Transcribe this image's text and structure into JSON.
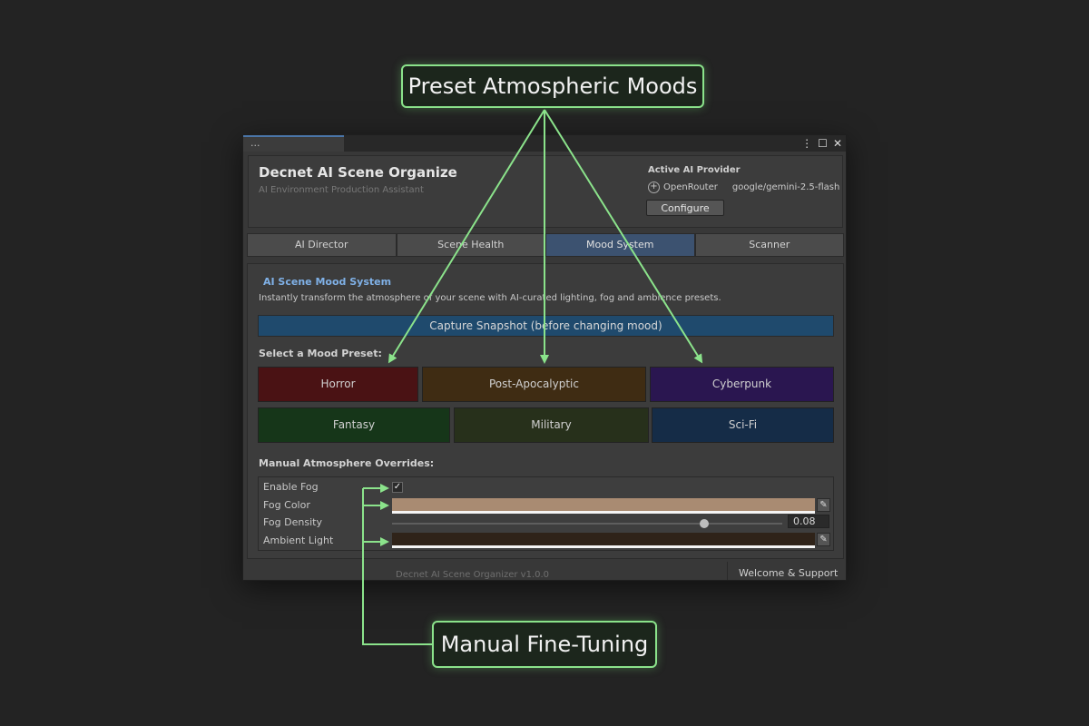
{
  "callouts": {
    "top": "Preset Atmospheric Moods",
    "bottom": "Manual Fine-Tuning"
  },
  "window": {
    "tab_label": "...",
    "controls": [
      "⋮",
      "☐",
      "✕"
    ]
  },
  "header": {
    "title": "Decnet AI Scene Organize",
    "subtitle": "AI Environment Production Assistant",
    "provider_title": "Active AI Provider",
    "provider_name": "OpenRouter",
    "provider_model": "google/gemini-2.5-flash",
    "configure_label": "Configure"
  },
  "tabs": [
    "AI Director",
    "Scene Health",
    "Mood System",
    "Scanner"
  ],
  "active_tab": "Mood System",
  "mood": {
    "title": "AI Scene Mood System",
    "description": "Instantly transform the atmosphere of your scene with AI-curated lighting, fog and ambience presets.",
    "snapshot_label": "Capture Snapshot (before changing mood)",
    "select_label": "Select a Mood Preset:",
    "presets": [
      {
        "label": "Horror",
        "color": "#4a1214"
      },
      {
        "label": "Post-Apocalyptic",
        "color": "#3f2c13"
      },
      {
        "label": "Cyberpunk",
        "color": "#2a1650"
      },
      {
        "label": "Fantasy",
        "color": "#163619"
      },
      {
        "label": "Military",
        "color": "#27301b"
      },
      {
        "label": "Sci-Fi",
        "color": "#152c47"
      }
    ]
  },
  "overrides": {
    "title": "Manual Atmosphere Overrides:",
    "enable_fog_label": "Enable Fog",
    "enable_fog_checked": true,
    "fog_color_label": "Fog Color",
    "fog_color": "#a98b72",
    "fog_density_label": "Fog Density",
    "fog_density_value": "0.08",
    "fog_density_fraction": 0.8,
    "ambient_light_label": "Ambient Light",
    "ambient_color": "#2f2319"
  },
  "footer": {
    "version_text": "Decnet AI Scene Organizer  v1.0.0",
    "support_label": "Welcome & Support"
  },
  "colors": {
    "accent": "#8be38b",
    "tab_active": "#3c5270",
    "snapshot": "#1f4a6d"
  }
}
